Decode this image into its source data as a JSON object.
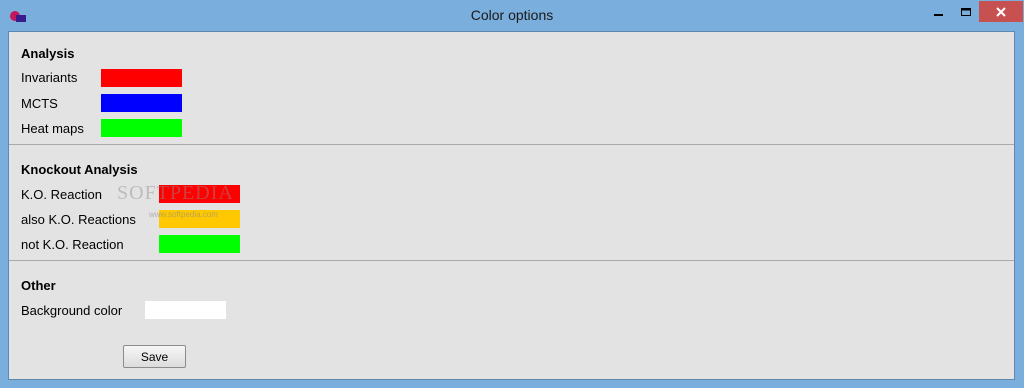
{
  "window": {
    "title": "Color options",
    "controls": {
      "minimize_icon": "minimize-icon",
      "maximize_icon": "maximize-icon",
      "close_icon": "close-icon"
    }
  },
  "analysis": {
    "title": "Analysis",
    "rows": [
      {
        "label": "Invariants",
        "color": "#ff0000"
      },
      {
        "label": "MCTS",
        "color": "#0000ff"
      },
      {
        "label": "Heat maps",
        "color": "#00ff00"
      }
    ]
  },
  "knockout": {
    "title": "Knockout Analysis",
    "rows": [
      {
        "label": "K.O. Reaction",
        "color": "#ff0000"
      },
      {
        "label": "also K.O. Reactions",
        "color": "#ffc800"
      },
      {
        "label": "not K.O. Reaction",
        "color": "#00ff00"
      }
    ]
  },
  "other": {
    "title": "Other",
    "rows": [
      {
        "label": "Background color",
        "color": "#ffffff"
      }
    ]
  },
  "save_label": "Save",
  "watermark": {
    "text": "SOFTPEDIA",
    "sub": "www.softpedia.com"
  }
}
